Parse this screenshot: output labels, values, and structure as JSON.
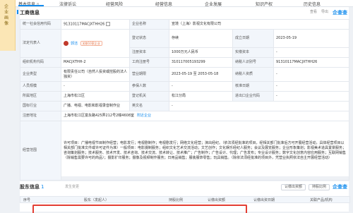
{
  "nav": {
    "items": [
      {
        "label": "基本信息",
        "count": "8"
      },
      {
        "label": "法律诉讼",
        "count": ""
      },
      {
        "label": "经营风险",
        "count": ""
      },
      {
        "label": "经营信息",
        "count": ""
      },
      {
        "label": "企业发展",
        "count": ""
      },
      {
        "label": "知识产权",
        "count": ""
      },
      {
        "label": "历史信息",
        "count": ""
      }
    ]
  },
  "side_tag": "企业画像",
  "panel": {
    "title": "工商信息",
    "tools": [
      "查看",
      "导出"
    ],
    "brand": "企查查"
  },
  "info": {
    "credit_code_label": "统一社会信用代码",
    "credit_code": "91310117MACJXTHH26",
    "company_name_label": "企业名称",
    "company_name": "宣境（上海）影视文化有限公司",
    "legal_rep_label": "法定代表人",
    "legal_rep": "郭洁",
    "legal_rep_tag": "关联10家企业",
    "reg_status_label": "登记状态",
    "reg_status": "存续",
    "established_label": "成立日期",
    "established": "2023-05-19",
    "reg_capital_label": "注册资本",
    "reg_capital": "1000万元人民币",
    "paid_capital_label": "实缴资本",
    "paid_capital": "-",
    "org_code_label": "组织机构代码",
    "org_code": "MACJXTHH-2",
    "biz_reg_no_label": "工商注册号",
    "biz_reg_no": "310117005193299",
    "taxpayer_id_label": "纳税人识别号",
    "taxpayer_id": "91310117MACJXTHH26",
    "company_type_label": "企业类型",
    "company_type": "有限责任公司（自然人投资或控股的法人独资）",
    "term_label": "营业期限",
    "term": "2023-05-19 至 2053-05-18",
    "taxpayer_qual_label": "纳税人资质",
    "taxpayer_qual": "-",
    "staff_label": "人员规模",
    "staff": "-",
    "insured_label": "参保人数",
    "insured": "-",
    "approval_label": "核准日期",
    "approval": "-",
    "region_label": "所属地区",
    "region": "上海市松江区",
    "authority_label": "登记机关",
    "authority": "松江分局",
    "import_export_label": "进出口企业代码",
    "import_export": "-",
    "industry_label": "国标行业",
    "industry": "广播、电视、电影和影视录音制作业",
    "en_name_label": "英文名",
    "en_name": "-",
    "address_label": "注册地址",
    "address": "上海市松江区富永路425弄212号2幢4608室",
    "address_tools": "附近企业",
    "scope_label": "经营范围",
    "scope": "许可项目：广播电视节目制作经营；电影发行；电视剧制作；电视剧发行；网络文化经营；演出经纪。（依法须经批准的项目，经相关部门批准后方可开展经营活动，具体经营项目以相关部门批准文件或许可证件为准）一般项目：电影摄制服务；组织文化艺术交流活动；文艺创作；文化娱乐经纪人服务；会议及展览服务；企业形象策划；影视美术道具置景服务；咨询策划服务；技术服务、技术开发、技术咨询、技术交流、技术转让、技术推广；广告制作；广告设计、代理；广告发布；专业设计服务；数字文化创意内容应用服务；互联网销售（除销售需要许可的商品）；摄影扩印服务；摄像及视频制作服务；日用品销售；服装服饰零售；玩具销售。（除依法须经批准的项目外，凭营业执照依法自主开展经营活动）"
  },
  "holders": {
    "title": "股东信息",
    "count": "1",
    "sub": "发生变更",
    "filter1": "认缴出资额",
    "filter2": "持股比例",
    "brand": "企查查",
    "columns": [
      "序号",
      "股东（发起人）",
      "持股比例",
      "认缴出资额",
      "认缴出资日期",
      "关联产品/机构"
    ]
  }
}
